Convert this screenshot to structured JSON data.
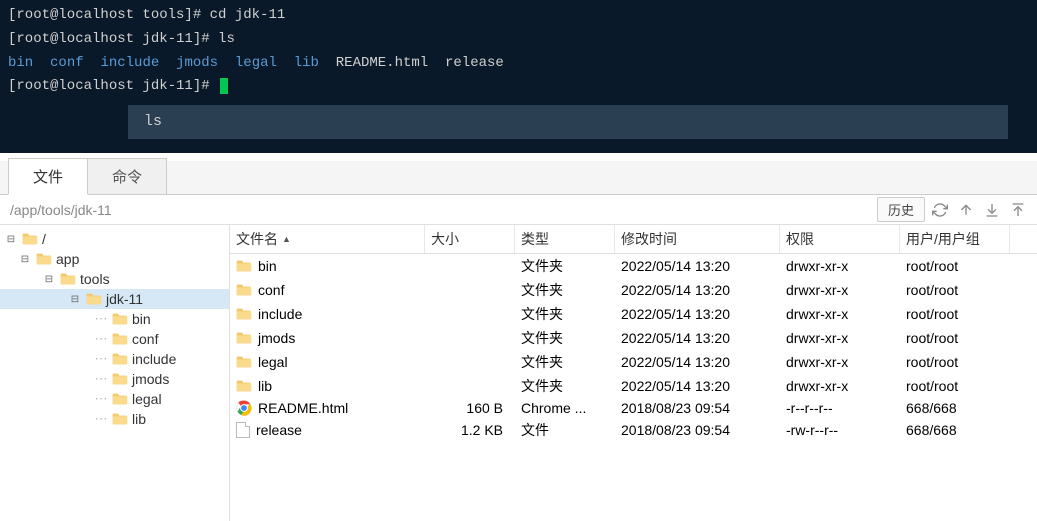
{
  "terminal": {
    "lines": [
      {
        "prompt": "[root@localhost tools]# ",
        "command": "cd jdk-11"
      },
      {
        "prompt": "[root@localhost jdk-11]# ",
        "command": "ls"
      }
    ],
    "ls_output": {
      "blue": [
        "bin",
        "conf",
        "include",
        "jmods",
        "legal",
        "lib"
      ],
      "white": [
        "README.html",
        "release"
      ]
    },
    "current_prompt": "[root@localhost jdk-11]# ",
    "search_value": "ls"
  },
  "tabs": {
    "file": "文件",
    "command": "命令"
  },
  "path": "/app/tools/jdk-11",
  "history_btn": "历史",
  "tree": [
    {
      "label": "/",
      "depth": 0,
      "expanded": true
    },
    {
      "label": "app",
      "depth": 1,
      "expanded": true
    },
    {
      "label": "tools",
      "depth": 2,
      "expanded": true
    },
    {
      "label": "jdk-11",
      "depth": 3,
      "expanded": true,
      "selected": true
    },
    {
      "label": "bin",
      "depth": 4,
      "leaf": true
    },
    {
      "label": "conf",
      "depth": 4,
      "leaf": true
    },
    {
      "label": "include",
      "depth": 4,
      "leaf": true
    },
    {
      "label": "jmods",
      "depth": 4,
      "leaf": true
    },
    {
      "label": "legal",
      "depth": 4,
      "leaf": true
    },
    {
      "label": "lib",
      "depth": 4,
      "leaf": true
    }
  ],
  "columns": {
    "name": "文件名",
    "size": "大小",
    "type": "类型",
    "mtime": "修改时间",
    "perm": "权限",
    "user": "用户/用户组"
  },
  "files": [
    {
      "name": "bin",
      "size": "",
      "type": "文件夹",
      "mtime": "2022/05/14 13:20",
      "perm": "drwxr-xr-x",
      "user": "root/root",
      "icon": "folder"
    },
    {
      "name": "conf",
      "size": "",
      "type": "文件夹",
      "mtime": "2022/05/14 13:20",
      "perm": "drwxr-xr-x",
      "user": "root/root",
      "icon": "folder"
    },
    {
      "name": "include",
      "size": "",
      "type": "文件夹",
      "mtime": "2022/05/14 13:20",
      "perm": "drwxr-xr-x",
      "user": "root/root",
      "icon": "folder"
    },
    {
      "name": "jmods",
      "size": "",
      "type": "文件夹",
      "mtime": "2022/05/14 13:20",
      "perm": "drwxr-xr-x",
      "user": "root/root",
      "icon": "folder"
    },
    {
      "name": "legal",
      "size": "",
      "type": "文件夹",
      "mtime": "2022/05/14 13:20",
      "perm": "drwxr-xr-x",
      "user": "root/root",
      "icon": "folder"
    },
    {
      "name": "lib",
      "size": "",
      "type": "文件夹",
      "mtime": "2022/05/14 13:20",
      "perm": "drwxr-xr-x",
      "user": "root/root",
      "icon": "folder"
    },
    {
      "name": "README.html",
      "size": "160 B",
      "type": "Chrome ...",
      "mtime": "2018/08/23 09:54",
      "perm": "-r--r--r--",
      "user": "668/668",
      "icon": "chrome"
    },
    {
      "name": "release",
      "size": "1.2 KB",
      "type": "文件",
      "mtime": "2018/08/23 09:54",
      "perm": "-rw-r--r--",
      "user": "668/668",
      "icon": "file"
    }
  ]
}
